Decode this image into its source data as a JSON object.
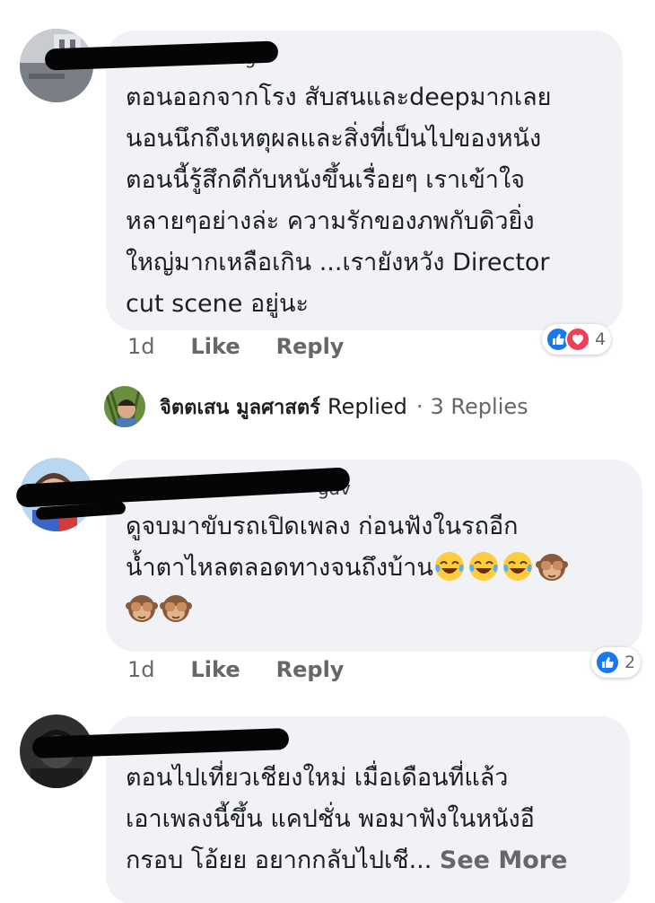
{
  "comments": [
    {
      "name_fragment": "ng",
      "text_lines": [
        "ตอนออกจากโรง สับสนและdeepมากเลย",
        "นอนนึกถึงเหตุผลและสิ่งที่เป็นไปของหนัง",
        "ตอนนี้รู้สึกดีกับหนังขึ้นเรื่อยๆ เราเข้าใจ",
        "หลายๆอย่างล่ะ ความรักของภพกับดิวยิ่ง",
        "ใหญ่มากเหลือเกิน ...เรายังหวัง Director",
        "cut scene อยู่นะ"
      ],
      "time": "1d",
      "like_label": "Like",
      "reply_label": "Reply",
      "reaction_count": "4",
      "reactions": [
        "like-icon",
        "love-icon"
      ]
    },
    {
      "name_fragment": "gav",
      "text_lines": [
        "ดูจบมาขับรถเปิดเพลง ก่อนฟังในรถอีก",
        "น้ำตาไหลตลอดทางจนถึงบ้าน"
      ],
      "emoji_line1": [
        "tears-of-joy-emoji",
        "tears-of-joy-emoji",
        "tears-of-joy-emoji",
        "see-no-evil-monkey-emoji"
      ],
      "emoji_line2": [
        "see-no-evil-monkey-emoji",
        "see-no-evil-monkey-emoji"
      ],
      "time": "1d",
      "like_label": "Like",
      "reply_label": "Reply",
      "reaction_count": "2",
      "reactions": [
        "like-icon"
      ]
    },
    {
      "text_lines": [
        "ตอนไปเที่ยวเชียงใหม่ เมื่อเดือนที่แล้ว",
        "เอาเพลงนี้ขึ้น แคปชั่น พอมาฟังในหนังอี",
        "กรอบ โอ้ยย อยากกลับไปเชี..."
      ],
      "see_more": "See More"
    }
  ],
  "reply_summary": {
    "name": "จิตตเสน มูลศาสตร์",
    "status": "Replied",
    "dot": "·",
    "count": "3 Replies"
  },
  "colors": {
    "bubble": "#f0f2f5",
    "text": "#1c1e21",
    "meta": "#65676b",
    "like_blue": "#1877f2",
    "love_red": "#f33e58"
  }
}
